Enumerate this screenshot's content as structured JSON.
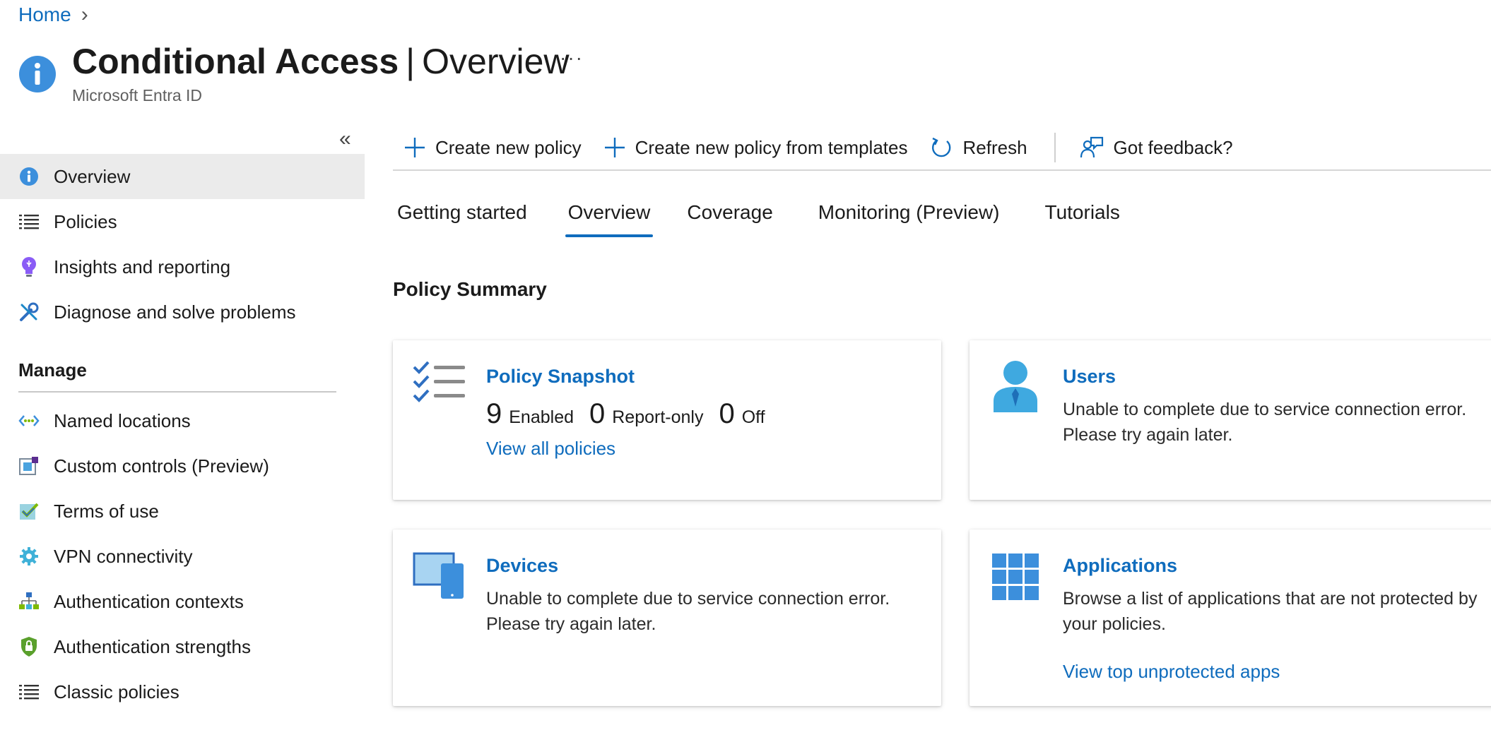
{
  "breadcrumb": {
    "home": "Home",
    "chevron": "›"
  },
  "header": {
    "title_bold": "Conditional Access",
    "separator": "|",
    "title_rest": "Overview",
    "more": "···",
    "subtitle": "Microsoft Entra ID"
  },
  "sidebar": {
    "collapse": "«",
    "items": [
      {
        "label": "Overview",
        "icon": "info-icon",
        "active": true
      },
      {
        "label": "Policies",
        "icon": "list-icon"
      },
      {
        "label": "Insights and reporting",
        "icon": "lightbulb-icon"
      },
      {
        "label": "Diagnose and solve problems",
        "icon": "wrench-icon"
      }
    ],
    "manage_heading": "Manage",
    "manage_items": [
      {
        "label": "Named locations",
        "icon": "network-icon"
      },
      {
        "label": "Custom controls (Preview)",
        "icon": "custom-controls-icon"
      },
      {
        "label": "Terms of use",
        "icon": "terms-checkmark-icon"
      },
      {
        "label": "VPN connectivity",
        "icon": "gear-icon"
      },
      {
        "label": "Authentication contexts",
        "icon": "hierarchy-icon"
      },
      {
        "label": "Authentication strengths",
        "icon": "shield-lock-icon"
      },
      {
        "label": "Classic policies",
        "icon": "list-icon"
      }
    ]
  },
  "toolbar": {
    "create_policy": "Create new policy",
    "create_from_templates": "Create new policy from templates",
    "refresh": "Refresh",
    "feedback": "Got feedback?"
  },
  "tabs": [
    {
      "label": "Getting started"
    },
    {
      "label": "Overview",
      "active": true
    },
    {
      "label": "Coverage"
    },
    {
      "label": "Monitoring (Preview)"
    },
    {
      "label": "Tutorials"
    }
  ],
  "summary": {
    "title": "Policy Summary",
    "snapshot": {
      "title": "Policy Snapshot",
      "enabled_count": "9",
      "enabled_label": "Enabled",
      "report_count": "0",
      "report_label": "Report-only",
      "off_count": "0",
      "off_label": "Off",
      "link": "View all policies"
    },
    "users": {
      "title": "Users",
      "line1": "Unable to complete due to service connection error.",
      "line2": "Please try again later."
    },
    "devices": {
      "title": "Devices",
      "line1": "Unable to complete due to service connection error.",
      "line2": "Please try again later."
    },
    "applications": {
      "title": "Applications",
      "line1": "Browse a list of applications that are not protected by",
      "line2": "your policies.",
      "link": "View top unprotected apps"
    }
  },
  "colors": {
    "accent": "#0f6cbd",
    "active_nav_bg": "#ebebeb",
    "icon_blue": "#4a90e2"
  }
}
